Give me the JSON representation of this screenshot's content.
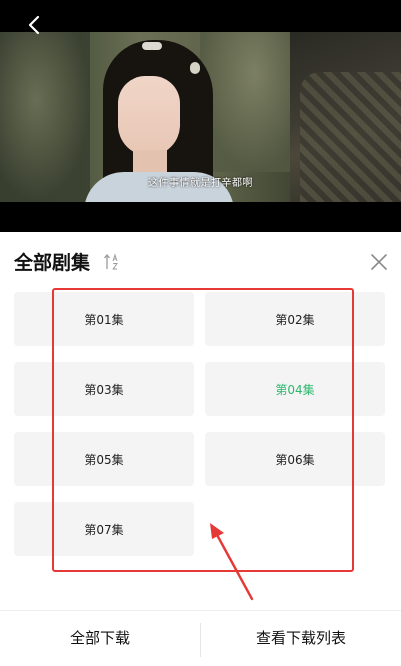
{
  "video": {
    "subtitle": "这件事情就是打辛都啊"
  },
  "panel": {
    "title": "全部剧集",
    "episodes": [
      {
        "label": "第01集",
        "active": false
      },
      {
        "label": "第02集",
        "active": false
      },
      {
        "label": "第03集",
        "active": false
      },
      {
        "label": "第04集",
        "active": true
      },
      {
        "label": "第05集",
        "active": false
      },
      {
        "label": "第06集",
        "active": false
      },
      {
        "label": "第07集",
        "active": false
      }
    ]
  },
  "footer": {
    "download_all": "全部下载",
    "view_downloads": "查看下载列表"
  },
  "colors": {
    "active_episode": "#2db86e",
    "highlight_annotation": "#e53935"
  },
  "icons": {
    "back": "back-arrow-icon",
    "sort": "sort-icon",
    "close": "close-icon"
  }
}
